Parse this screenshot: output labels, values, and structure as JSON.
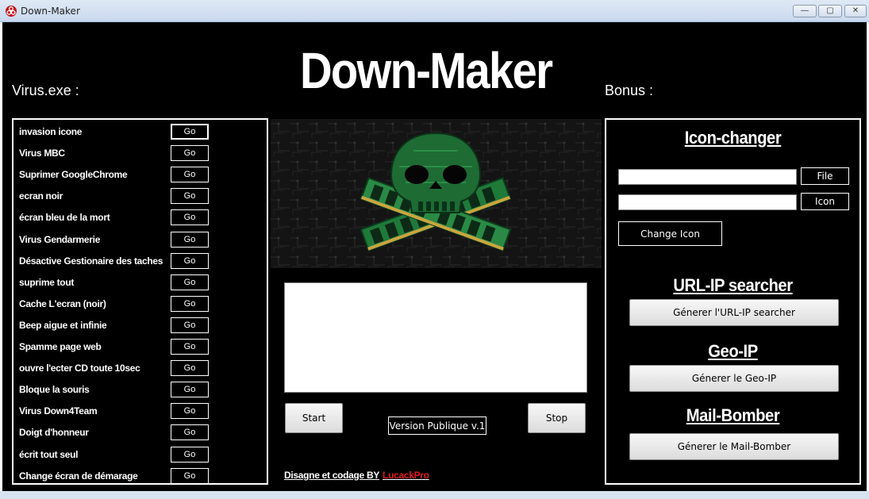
{
  "window": {
    "title": "Down-Maker",
    "icon": "biohazard-icon",
    "minimize": "—",
    "maximize": "▢",
    "close": "✕"
  },
  "header": {
    "title": "Down-Maker",
    "left_label": "Virus.exe :",
    "right_label": "Bonus :"
  },
  "viruses": [
    {
      "label": "invasion icone",
      "button": "Go"
    },
    {
      "label": "Virus MBC",
      "button": "Go"
    },
    {
      "label": "Suprimer GoogleChrome",
      "button": "Go"
    },
    {
      "label": "ecran noir",
      "button": "Go"
    },
    {
      "label": "écran bleu de la mort",
      "button": "Go"
    },
    {
      "label": "Virus Gendarmerie",
      "button": "Go"
    },
    {
      "label": "Désactive Gestionaire des taches",
      "button": "Go"
    },
    {
      "label": "suprime tout",
      "button": "Go"
    },
    {
      "label": "Cache L'ecran (noir)",
      "button": "Go"
    },
    {
      "label": "Beep aigue et infinie",
      "button": "Go"
    },
    {
      "label": "Spamme page web",
      "button": "Go"
    },
    {
      "label": "ouvre l'ecter CD toute 10sec",
      "button": "Go"
    },
    {
      "label": "Bloque la souris",
      "button": "Go"
    },
    {
      "label": "Virus Down4Team",
      "button": "Go"
    },
    {
      "label": "Doigt d'honneur",
      "button": "Go"
    },
    {
      "label": "écrit tout seul",
      "button": "Go"
    },
    {
      "label": "Change écran de démarage",
      "button": "Go"
    }
  ],
  "center": {
    "banner": "skull-crossbones-ram-icon",
    "output_value": "",
    "start_label": "Start",
    "stop_label": "Stop",
    "version": "Version Publique v.1",
    "credit": "Disagne et codage BY",
    "author": "LucackPro"
  },
  "bonus": {
    "icon_changer": {
      "heading": "Icon-changer",
      "file_value": "",
      "icon_value": "",
      "file_button": "File",
      "icon_button": "Icon",
      "change_button": "Change Icon"
    },
    "url_ip": {
      "heading": "URL-IP searcher",
      "button": "Génerer l'URL-IP searcher"
    },
    "geo_ip": {
      "heading": "Geo-IP",
      "button": "Génerer le Geo-IP"
    },
    "mail_bomber": {
      "heading": "Mail-Bomber",
      "button": "Génerer le Mail-Bomber"
    }
  }
}
